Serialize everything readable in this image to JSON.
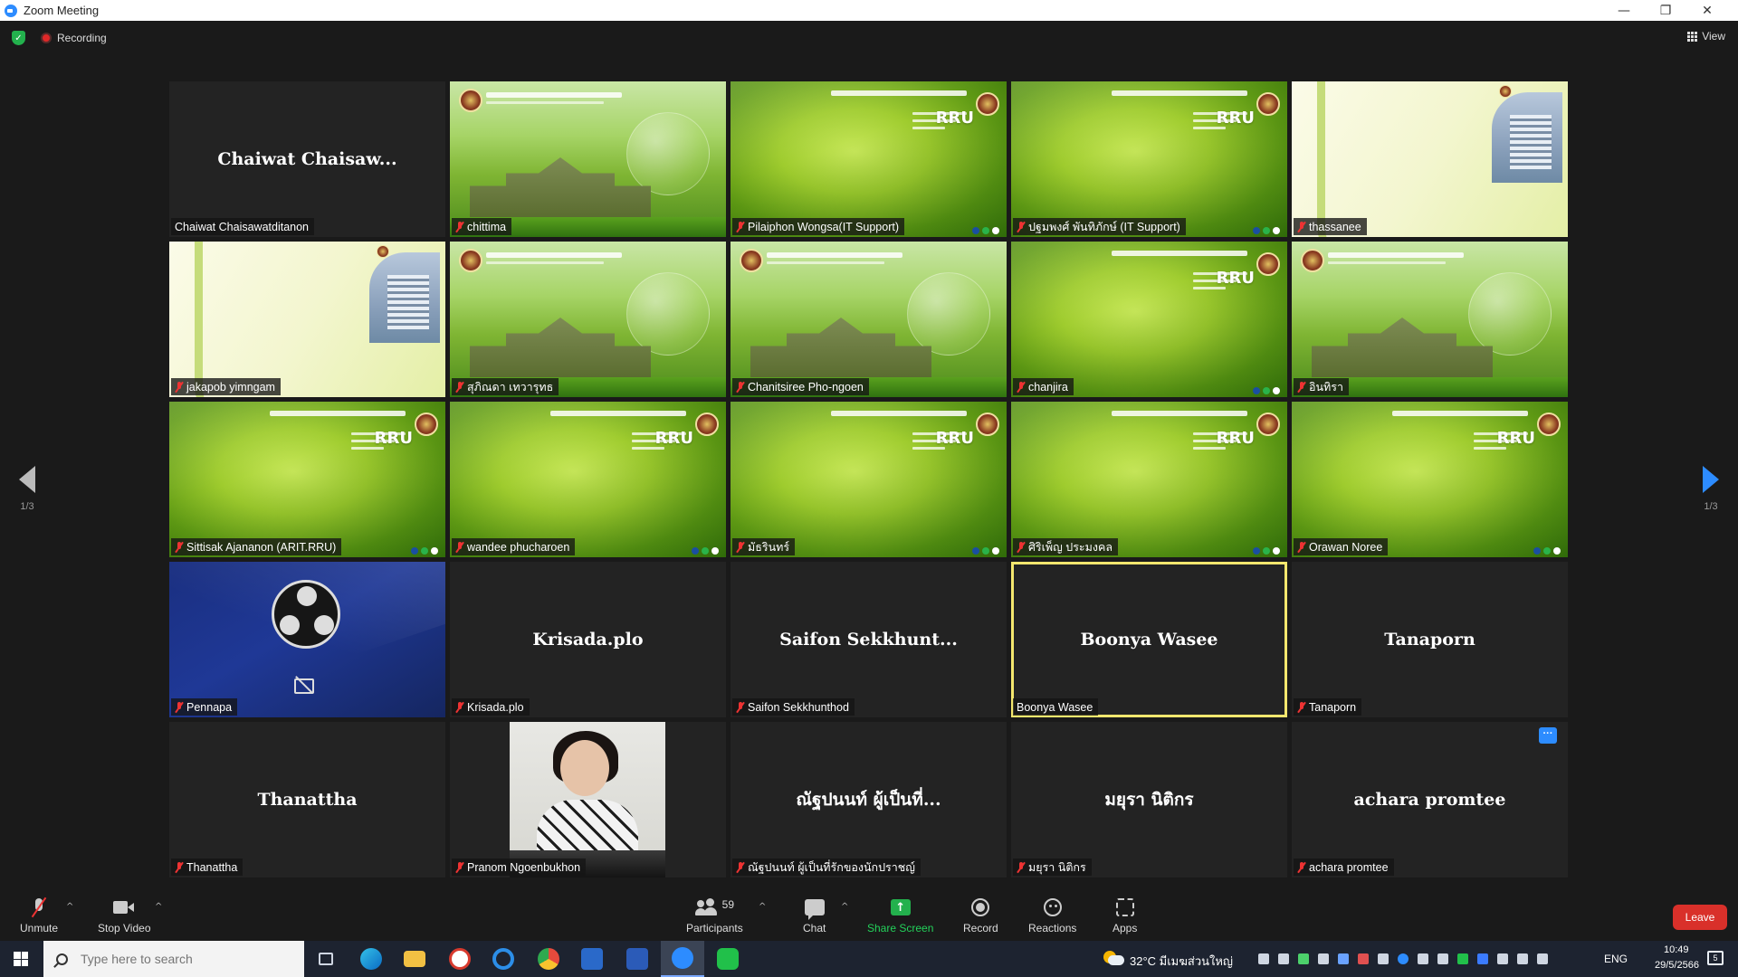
{
  "window": {
    "title": "Zoom Meeting",
    "controls": {
      "minimize": "—",
      "restore": "❐",
      "close": "✕"
    }
  },
  "topbar": {
    "recording_label": "Recording",
    "view_label": "View"
  },
  "navigation": {
    "left_page": "1/3",
    "right_page": "1/3"
  },
  "participants": [
    {
      "name": "Chaiwat Chaisawatditanon",
      "display": "Chaiwat Chaisaw...",
      "bg": "dark",
      "muted": false
    },
    {
      "name": "chittima",
      "bg": "campus",
      "muted": true
    },
    {
      "name": "Pilaiphon Wongsa(IT Support)",
      "bg": "green",
      "muted": true
    },
    {
      "name": "ปฐมพงศ์ พันทิภักษ์ (IT Support)",
      "bg": "green",
      "muted": true
    },
    {
      "name": "thassanee",
      "bg": "cream",
      "muted": true
    },
    {
      "name": "jakapob yimngam",
      "bg": "cream",
      "muted": true
    },
    {
      "name": "สุภิณดา เทวารุทธ",
      "bg": "campus",
      "muted": true
    },
    {
      "name": "Chanitsiree Pho-ngoen",
      "bg": "campus",
      "muted": true
    },
    {
      "name": "chanjira",
      "bg": "green",
      "muted": true
    },
    {
      "name": "อินทิรา",
      "bg": "campus",
      "muted": true
    },
    {
      "name": "Sittisak Ajananon (ARIT.RRU)",
      "bg": "green",
      "muted": true
    },
    {
      "name": "wandee phucharoen",
      "bg": "green",
      "muted": true
    },
    {
      "name": "มัธรินทร์",
      "bg": "green",
      "muted": true
    },
    {
      "name": "ศิริเพ็ญ ประมงคล",
      "bg": "green",
      "muted": true
    },
    {
      "name": "Orawan Noree",
      "bg": "green",
      "muted": true
    },
    {
      "name": "Pennapa",
      "bg": "obs",
      "muted": true
    },
    {
      "name": "Krisada.plo",
      "display": "Krisada.plo",
      "bg": "dark",
      "muted": true
    },
    {
      "name": "Saifon Sekkhunthod",
      "display": "Saifon  Sekkhunt...",
      "bg": "dark",
      "muted": true
    },
    {
      "name": "Boonya Wasee",
      "display": "Boonya Wasee",
      "bg": "dark",
      "muted": false,
      "active": true
    },
    {
      "name": "Tanaporn",
      "display": "Tanaporn",
      "bg": "dark",
      "muted": true
    },
    {
      "name": "Thanattha",
      "display": "Thanattha",
      "bg": "dark",
      "muted": true
    },
    {
      "name": "Pranom Ngoenbukhon",
      "bg": "video",
      "muted": true
    },
    {
      "name": "ณัฐปนนท์ ผู้เป็นที่รักของนักปราชญ์",
      "display": "ณัฐปนนท์ ผู้เป็นที่...",
      "bg": "dark",
      "muted": true
    },
    {
      "name": "มยุรา นิติกร",
      "display": "มยุรา นิติกร",
      "bg": "dark",
      "muted": true
    },
    {
      "name": "achara promtee",
      "display": "achara promtee",
      "bg": "dark",
      "muted": true,
      "more_button": "···"
    }
  ],
  "toolbar": {
    "unmute": "Unmute",
    "stop_video": "Stop Video",
    "participants_count": "59",
    "participants": "Participants",
    "chat": "Chat",
    "share_screen": "Share Screen",
    "share_arrow": "↑",
    "record": "Record",
    "reactions": "Reactions",
    "apps": "Apps",
    "leave": "Leave",
    "caret": "^"
  },
  "taskbar": {
    "search_placeholder": "Type here to search",
    "weather": "32°C  มีเมฆส่วนใหญ่",
    "language": "ENG",
    "time": "10:49",
    "date": "29/5/2566",
    "notification_count": "5"
  },
  "colors": {
    "zoom_blue": "#2d8cff",
    "leave_red": "#d9302a",
    "share_green": "#23b14d",
    "active_speaker": "#f4e76e"
  }
}
